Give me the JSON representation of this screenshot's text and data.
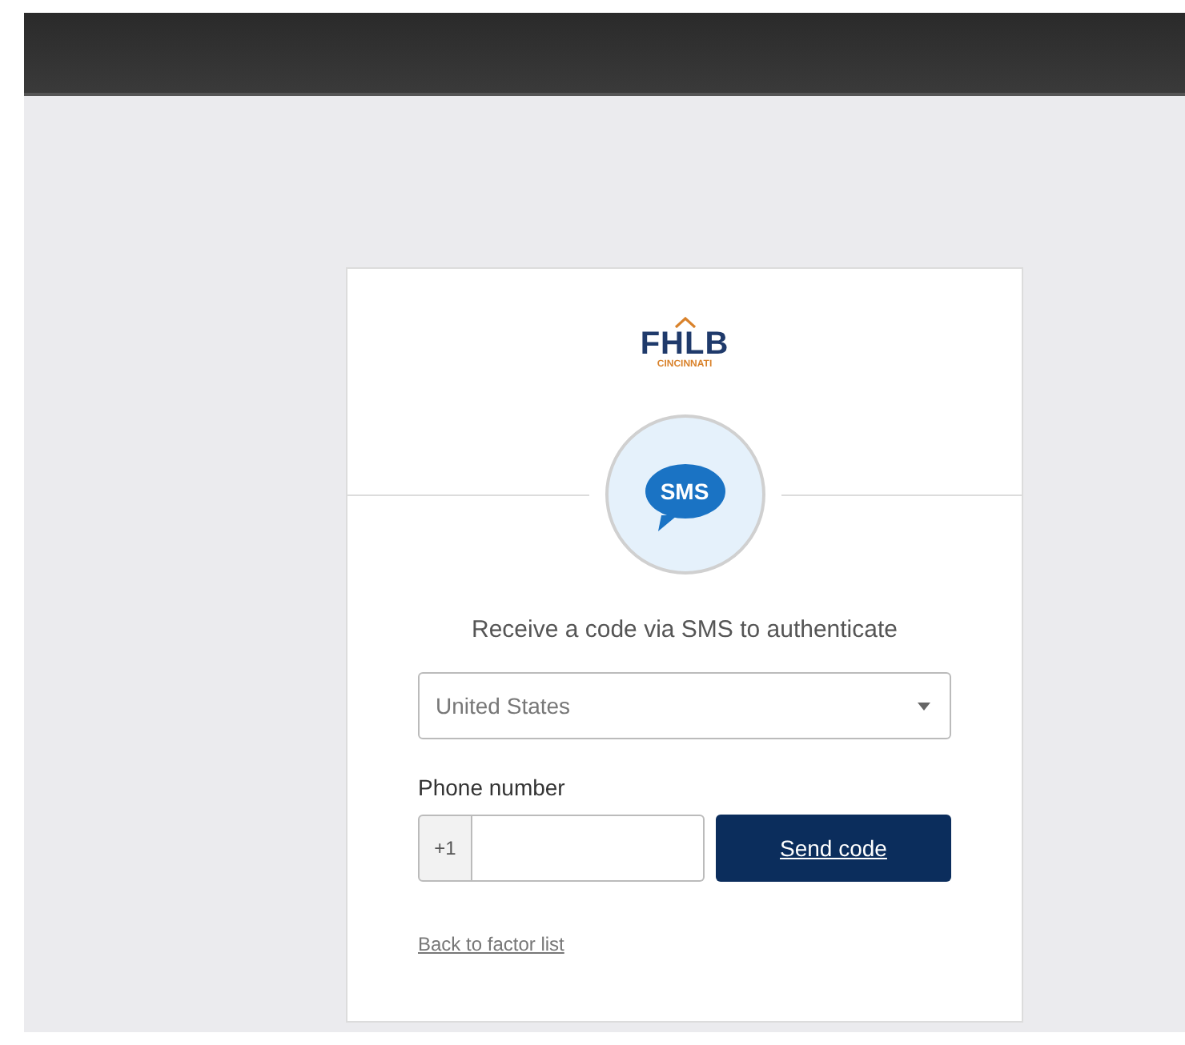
{
  "logo": {
    "name": "FHLB",
    "subtitle": "CINCINNATI"
  },
  "factor": {
    "badge": "SMS"
  },
  "prompt": "Receive a code via SMS to authenticate",
  "country_select": {
    "value": "United States"
  },
  "phone": {
    "label": "Phone number",
    "prefix": "+1"
  },
  "send_button": "Send code",
  "back_link": "Back to factor list"
}
